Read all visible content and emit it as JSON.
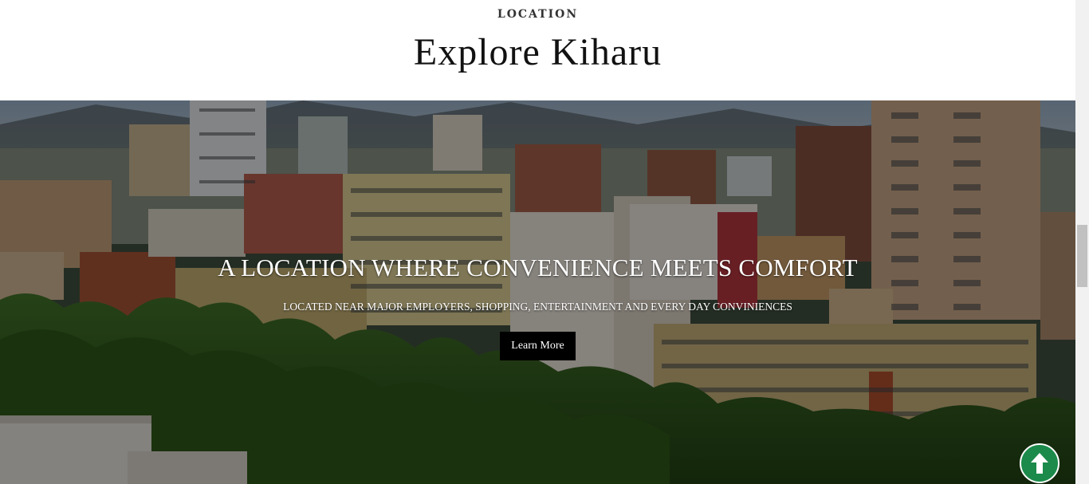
{
  "header": {
    "eyebrow": "LOCATION",
    "title": "Explore Kiharu"
  },
  "hero": {
    "background": "city-skyline-photo",
    "heading": "A LOCATION WHERE CONVENIENCE MEETS COMFORT",
    "subheading": "LOCATED NEAR MAJOR EMPLOYERS, SHOPPING, ENTERTAINMENT AND EVERY DAY CONVINIENCES",
    "button_label": "Learn More"
  },
  "back_to_top": {
    "icon": "arrow-up-icon",
    "color": "#1b8a4a"
  }
}
